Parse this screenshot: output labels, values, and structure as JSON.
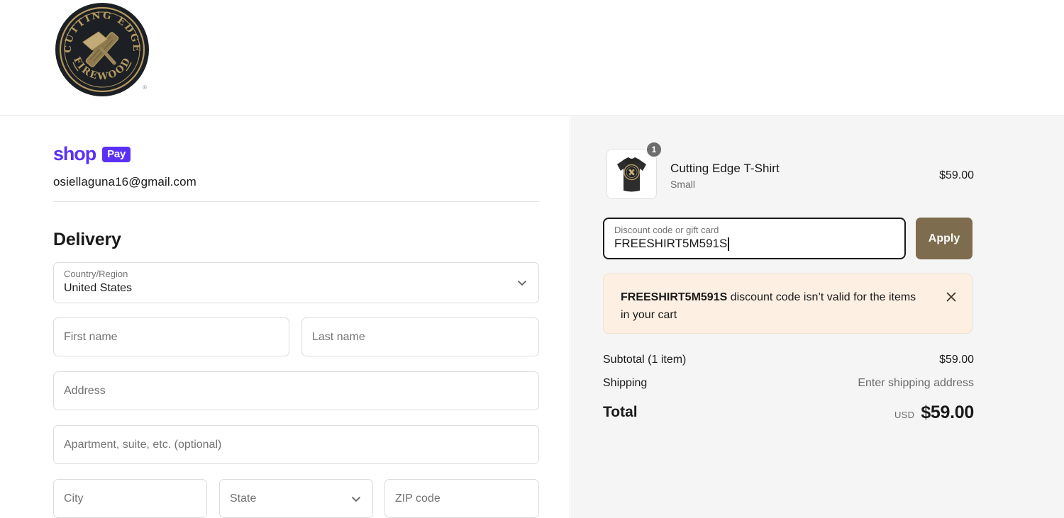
{
  "header": {
    "logo": {
      "name": "cutting-edge-firewood-logo",
      "top_text": "CUTTING EDGE",
      "bottom_text": "FIREWOOD",
      "registered_mark": "®",
      "dark_color": "#1c2024",
      "gold_color": "#b59a62"
    }
  },
  "left": {
    "shop_pay": {
      "word": "shop",
      "badge": "Pay",
      "brand_color": "#5a31f4"
    },
    "email": "osiellaguna16@gmail.com",
    "delivery_heading": "Delivery",
    "country_field": {
      "label": "Country/Region",
      "value": "United States",
      "icon": "chevron-down-icon"
    },
    "fields": [
      {
        "name": "first-name-field",
        "placeholder": "First name"
      },
      {
        "name": "last-name-field",
        "placeholder": "Last name"
      },
      {
        "name": "address-field",
        "placeholder": "Address"
      },
      {
        "name": "apartment-field",
        "placeholder": "Apartment, suite, etc. (optional)"
      },
      {
        "name": "city-field",
        "placeholder": "City"
      },
      {
        "name": "state-field",
        "placeholder": "State"
      },
      {
        "name": "zip-field",
        "placeholder": "ZIP code"
      }
    ],
    "state_icon": "chevron-down-icon"
  },
  "right": {
    "product": {
      "title": "Cutting Edge T-Shirt",
      "variant": "Small",
      "price": "$59.00",
      "quantity": "1",
      "thumbnail_icon": "tshirt-thumbnail"
    },
    "discount": {
      "label": "Discount code or gift card",
      "value": "FREESHIRT5M591S",
      "apply_label": "Apply",
      "apply_color": "#7e6c4e"
    },
    "error": {
      "code": "FREESHIRT5M591S",
      "message": " discount code isn’t valid for the items in your cart",
      "close_icon": "close-icon",
      "background_color": "#fdf0e3"
    },
    "summary": [
      {
        "label": "Subtotal (1 item)",
        "value": "$59.00",
        "muted": false
      },
      {
        "label": "Shipping",
        "value": "Enter shipping address",
        "muted": true
      }
    ],
    "total": {
      "label": "Total",
      "currency": "USD",
      "amount": "$59.00"
    }
  }
}
